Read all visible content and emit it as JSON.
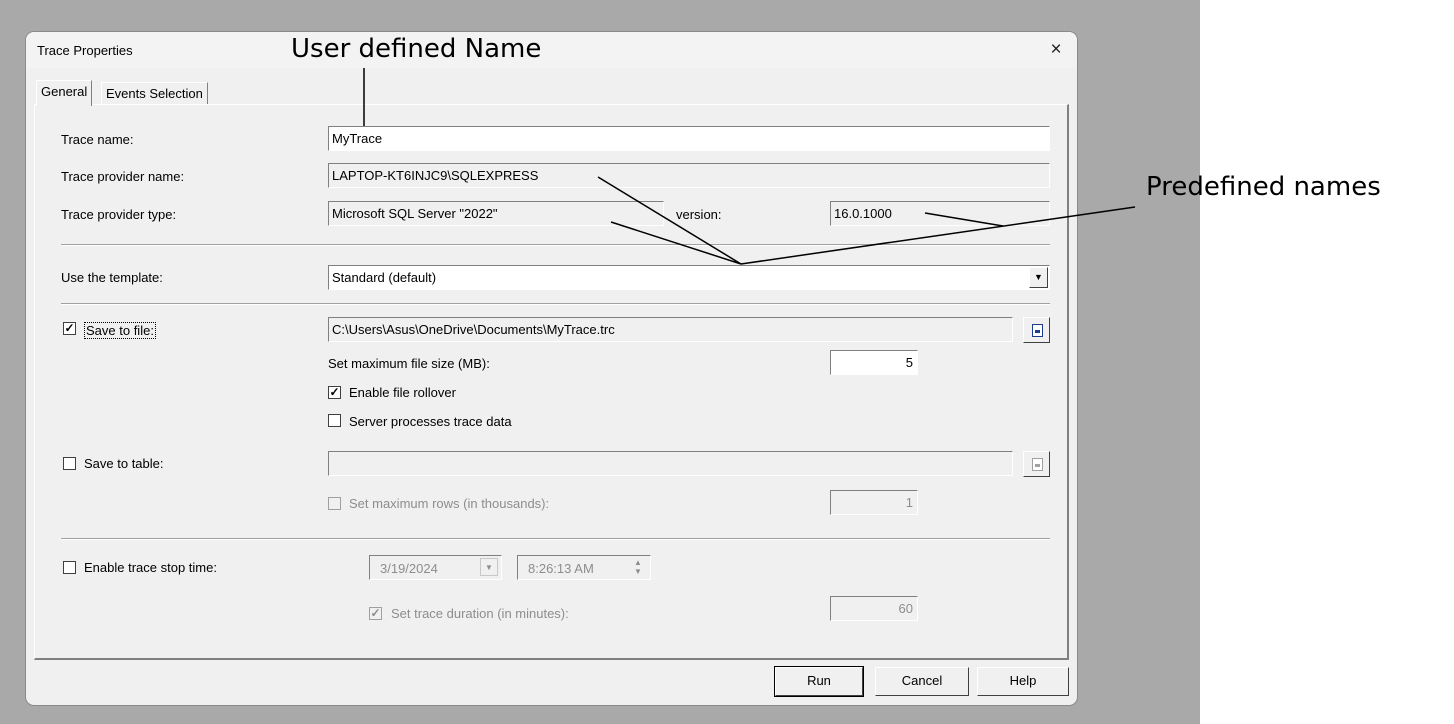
{
  "window": {
    "title": "Trace Properties",
    "close": "×"
  },
  "tabs": [
    {
      "label": "General"
    },
    {
      "label": "Events Selection"
    }
  ],
  "general": {
    "trace_name_label": "Trace name:",
    "trace_name_value": "MyTrace",
    "provider_name_label": "Trace provider name:",
    "provider_name_value": "LAPTOP-KT6INJC9\\SQLEXPRESS",
    "provider_type_label": "Trace provider type:",
    "provider_type_value": "Microsoft SQL Server \"2022\"",
    "version_label": "version:",
    "version_value": "16.0.1000",
    "template_label": "Use the template:",
    "template_value": "Standard (default)",
    "save_to_file": {
      "checked": true,
      "label": "Save to file:",
      "path": "C:\\Users\\Asus\\OneDrive\\Documents\\MyTrace.trc",
      "max_size_label": "Set maximum file size (MB):",
      "max_size_value": "5",
      "rollover_label": "Enable file rollover",
      "rollover_checked": true,
      "server_processes_label": "Server processes trace data",
      "server_processes_checked": false
    },
    "save_to_table": {
      "checked": false,
      "label": "Save to table:",
      "table_value": "",
      "max_rows_label": "Set maximum rows (in thousands):",
      "max_rows_value": "1"
    },
    "stop_time": {
      "checked": false,
      "label": "Enable trace stop time:",
      "date": "3/19/2024",
      "time": "8:26:13 AM",
      "duration_label": "Set trace duration (in minutes):",
      "duration_checked": true,
      "duration_value": "60"
    }
  },
  "buttons": {
    "run": "Run",
    "cancel": "Cancel",
    "help": "Help"
  },
  "annotations": {
    "user_defined": "User defined Name",
    "predefined": "Predefined names"
  }
}
